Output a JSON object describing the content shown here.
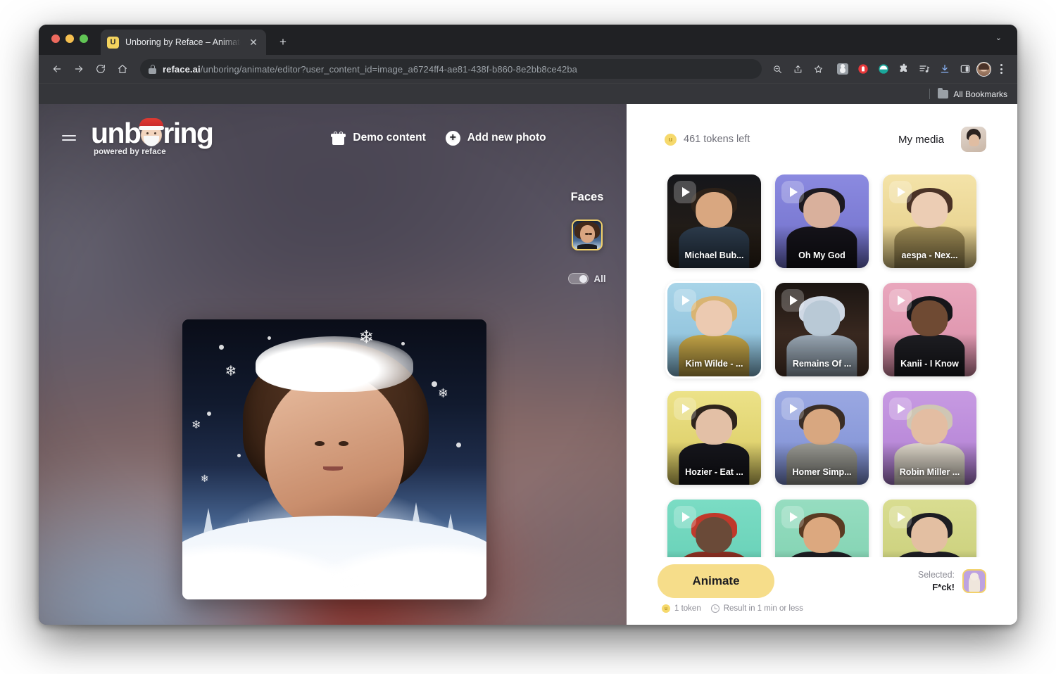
{
  "browser": {
    "tab": {
      "title": "Unboring by Reface – Animate",
      "favicon_letter": "U",
      "close_label": "✕"
    },
    "new_tab_label": "+",
    "tab_list_chevron": "⌄",
    "url_domain": "reface.ai",
    "url_path": "/unboring/animate/editor?user_content_id=image_a6724ff4-ae81-438f-b860-8e2bb8ce42ba",
    "bookmarks_label": "All Bookmarks",
    "icons": {
      "back": "back-arrow-icon",
      "forward": "forward-arrow-icon",
      "reload": "reload-icon",
      "home": "home-icon",
      "lock": "lock-icon",
      "zoom": "search-page-icon",
      "share": "share-icon",
      "bookmark": "star-icon",
      "profile_ext": "contact-extension-icon",
      "adblock": "adblock-extension-icon",
      "cloud": "cloud-extension-icon",
      "puzzle": "extensions-puzzle-icon",
      "playlist": "media-playlist-icon",
      "download": "download-icon",
      "side_panel": "side-panel-icon",
      "avatar": "profile-avatar-icon",
      "menu": "kebab-menu-icon"
    }
  },
  "app": {
    "menu_label": "menu-icon",
    "logo": {
      "word_before": "unb",
      "word_after": "ring",
      "tagline": "powered by reface"
    },
    "header_actions": [
      {
        "label": "Demo content",
        "icon": "gift-icon"
      },
      {
        "label": "Add new photo",
        "icon": "plus-circle-icon"
      }
    ],
    "faces": {
      "title": "Faces",
      "toggle_label": "All",
      "toggle_on": false
    }
  },
  "panel": {
    "tokens_text": "461 tokens left",
    "coin_glyph": "u",
    "my_media_label": "My media"
  },
  "grid": {
    "cards": [
      {
        "title": "Michael Bub...",
        "bg": "#15161a",
        "bg2": "#2b2015",
        "hair": "#2c2118",
        "skin": "#d9a780",
        "body": "#2c3b4c",
        "selected": false
      },
      {
        "title": "Oh My God",
        "bg": "#8b8ae0",
        "bg2": "#6f6ec9",
        "hair": "#1d1a20",
        "skin": "#d9b09c",
        "body": "#15131a",
        "selected": false
      },
      {
        "title": "aespa - Nex...",
        "bg": "#f4e3a8",
        "bg2": "#e2cb85",
        "hair": "#4a3226",
        "skin": "#eccdb4",
        "body": "#9d8a54",
        "selected": false
      },
      {
        "title": "Kim Wilde - ...",
        "bg": "#a8d4e8",
        "bg2": "#87bcd8",
        "hair": "#d9b472",
        "skin": "#eccab1",
        "body": "#c3a447",
        "selected": true
      },
      {
        "title": "Remains Of ...",
        "bg": "#1b1512",
        "bg2": "#50372a",
        "hair": "#cfd8e4",
        "skin": "#b9c9d6",
        "body": "#9aa8b5",
        "selected": false
      },
      {
        "title": "Kanii - I Know",
        "bg": "#e9a7bd",
        "bg2": "#d98ca6",
        "hair": "#16161a",
        "skin": "#6f4a33",
        "body": "#1d1d22",
        "selected": false
      },
      {
        "title": "Hozier - Eat ...",
        "bg": "#ece288",
        "bg2": "#d8c85e",
        "hair": "#2e241c",
        "skin": "#e3c0a6",
        "body": "#16161c",
        "selected": false
      },
      {
        "title": "Homer Simp...",
        "bg": "#9aa8e2",
        "bg2": "#7d8ed3",
        "hair": "#3a2d25",
        "skin": "#d8a780",
        "body": "#9a9a93",
        "selected": false
      },
      {
        "title": "Robin Miller ...",
        "bg": "#c79ae2",
        "bg2": "#b07ed3",
        "hair": "#cfc6b4",
        "skin": "#e3bda2",
        "body": "#ddd6c9",
        "selected": false
      },
      {
        "title": "",
        "bg": "#7bdcc4",
        "bg2": "#61cdb3",
        "hair": "#c0392b",
        "skin": "#6a4a38",
        "body": "#8a2f22",
        "selected": false
      },
      {
        "title": "",
        "bg": "#96ddc0",
        "bg2": "#7ccfae",
        "hair": "#5a3a22",
        "skin": "#dca87f",
        "body": "#1d1d22",
        "selected": false
      },
      {
        "title": "",
        "bg": "#d9dd91",
        "bg2": "#c6cb74",
        "hair": "#1d1d22",
        "skin": "#e3bfa2",
        "body": "#1d1d22",
        "selected": false
      }
    ]
  },
  "footer": {
    "animate_label": "Animate",
    "token_cost": "1 token",
    "result_time": "Result in 1 min or less",
    "selected_label": "Selected:",
    "selected_name": "F*ck!"
  }
}
